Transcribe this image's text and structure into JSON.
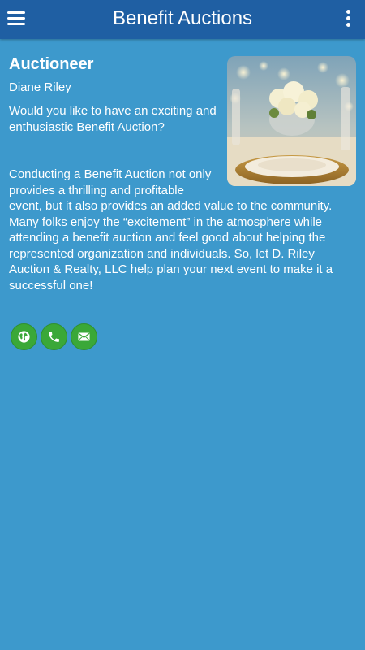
{
  "app_bar": {
    "title": "Benefit Auctions",
    "menu_icon": "hamburger-menu-icon",
    "overflow_icon": "more-vertical-icon",
    "background": "#1f5fa3"
  },
  "content": {
    "heading": "Auctioneer",
    "subheading": "Diane Riley",
    "intro": "Would you like to have an exciting and enthusiastic Benefit Auction?",
    "body": "Conducting a Benefit Auction not only provides a thrilling and profitable event, but it also provides an added value to the community. Many folks enjoy the “excitement” in the atmosphere while attending a benefit auction and feel good about helping the represented organization and individuals. So, let D. Riley Auction & Realty, LLC help plan your next event to make it a successful one!",
    "image": "table-setting-with-roses-photo",
    "background": "#3d99cc"
  },
  "actions": [
    {
      "name": "website",
      "icon": "globe-icon"
    },
    {
      "name": "call",
      "icon": "phone-icon"
    },
    {
      "name": "email",
      "icon": "envelope-icon"
    }
  ],
  "colors": {
    "action_button": "#3aa838"
  }
}
